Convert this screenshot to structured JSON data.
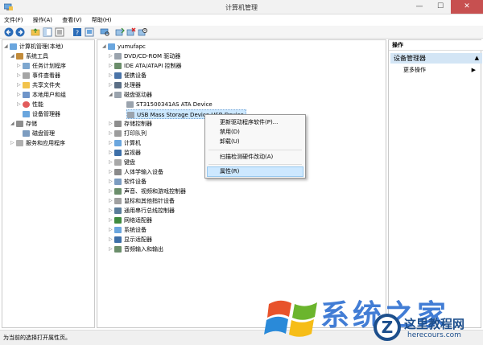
{
  "window": {
    "title": "计算机管理"
  },
  "menu": [
    {
      "label": "文件(F)"
    },
    {
      "label": "操作(A)"
    },
    {
      "label": "查看(V)"
    },
    {
      "label": "帮助(H)"
    }
  ],
  "left_tree": {
    "root": "计算机管理(本地)",
    "system_tools": "系统工具",
    "items": [
      {
        "label": "任务计划程序"
      },
      {
        "label": "事件查看器"
      },
      {
        "label": "共享文件夹"
      },
      {
        "label": "本地用户和组"
      },
      {
        "label": "性能"
      },
      {
        "label": "设备管理器"
      }
    ],
    "storage": "存储",
    "disk_mgmt": "磁盘管理",
    "services": "服务和应用程序"
  },
  "device_tree": {
    "root": "yumufapc",
    "categories_top": [
      {
        "label": "DVD/CD-ROM 驱动器"
      },
      {
        "label": "IDE ATA/ATAPI 控制器"
      },
      {
        "label": "便携设备"
      },
      {
        "label": "处理器"
      },
      {
        "label": "磁盘驱动器"
      }
    ],
    "disk_children": [
      {
        "label": "ST31500341AS ATA Device"
      },
      {
        "label": "USB Mass Storage Device USB Device"
      }
    ],
    "categories_bottom": [
      {
        "label": "存储控制器"
      },
      {
        "label": "打印队列"
      },
      {
        "label": "计算机"
      },
      {
        "label": "监视器"
      },
      {
        "label": "键盘"
      },
      {
        "label": "人体学输入设备"
      },
      {
        "label": "软件设备"
      },
      {
        "label": "声音、视频和游戏控制器"
      },
      {
        "label": "鼠标和其他指针设备"
      },
      {
        "label": "通用串行总线控制器"
      },
      {
        "label": "网络适配器"
      },
      {
        "label": "系统设备"
      },
      {
        "label": "显示适配器"
      },
      {
        "label": "音频输入和输出"
      }
    ]
  },
  "context_menu": {
    "update": "更新驱动程序软件(P)...",
    "disable": "禁用(D)",
    "uninstall": "卸载(U)",
    "scan": "扫描检测硬件改动(A)",
    "properties": "属性(R)"
  },
  "actions": {
    "header": "操作",
    "section": "设备管理器",
    "more": "更多操作"
  },
  "status": "为当前的选择打开属性页。",
  "watermark": {
    "text": "系统之家",
    "site_name": "这里教程网",
    "site_url": "herecours.com"
  }
}
